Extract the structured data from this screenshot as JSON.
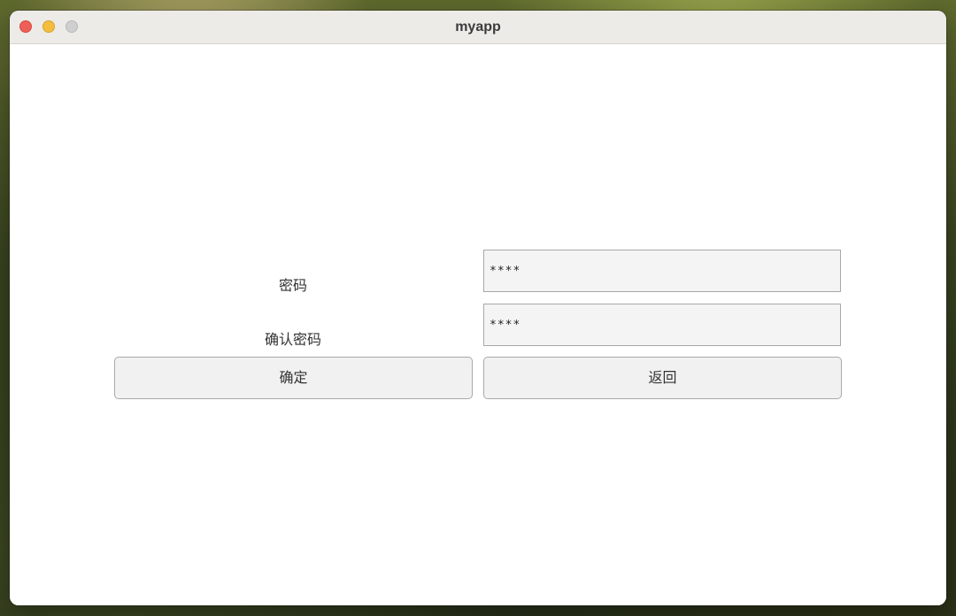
{
  "window": {
    "title": "myapp"
  },
  "form": {
    "password": {
      "label": "密码",
      "value": "****"
    },
    "confirm_password": {
      "label": "确认密码",
      "value": "****"
    }
  },
  "buttons": {
    "confirm_label": "确定",
    "back_label": "返回"
  },
  "colors": {
    "close": "#ee5f57",
    "minimize": "#f4bd3f",
    "zoom": "#cfcfcf"
  }
}
